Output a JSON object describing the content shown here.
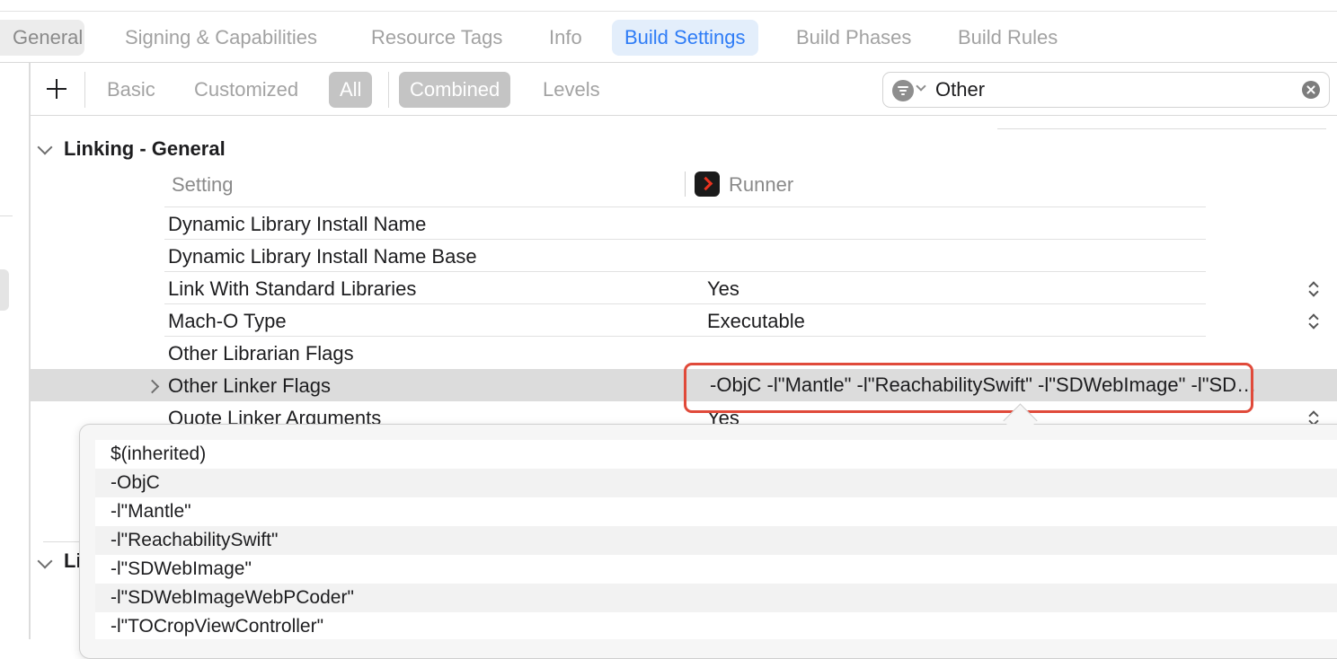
{
  "tabs": [
    {
      "label": "General"
    },
    {
      "label": "Signing & Capabilities"
    },
    {
      "label": "Resource Tags"
    },
    {
      "label": "Info"
    },
    {
      "label": "Build Settings"
    },
    {
      "label": "Build Phases"
    },
    {
      "label": "Build Rules"
    }
  ],
  "toolbar": {
    "basic": "Basic",
    "customized": "Customized",
    "all": "All",
    "combined": "Combined",
    "levels": "Levels"
  },
  "search": {
    "value": "Other"
  },
  "section": {
    "title": "Linking - General",
    "setting_header": "Setting",
    "target_header": "Runner",
    "rows": [
      {
        "label": "Dynamic Library Install Name",
        "value": ""
      },
      {
        "label": "Dynamic Library Install Name Base",
        "value": ""
      },
      {
        "label": "Link With Standard Libraries",
        "value": "Yes"
      },
      {
        "label": "Mach-O Type",
        "value": "Executable"
      },
      {
        "label": "Other Librarian Flags",
        "value": ""
      },
      {
        "label": "Other Linker Flags",
        "value": "-ObjC -l\"Mantle\" -l\"ReachabilitySwift\" -l\"SDWebImage\" -l\"SD…"
      },
      {
        "label": "Quote Linker Arguments",
        "value": "Yes"
      }
    ]
  },
  "next_section_title": "Li",
  "popover": {
    "items": [
      "$(inherited)",
      "-ObjC",
      "-l\"Mantle\"",
      "-l\"ReachabilitySwift\"",
      "-l\"SDWebImage\"",
      "-l\"SDWebImageWebPCoder\"",
      "-l\"TOCropViewController\""
    ]
  }
}
